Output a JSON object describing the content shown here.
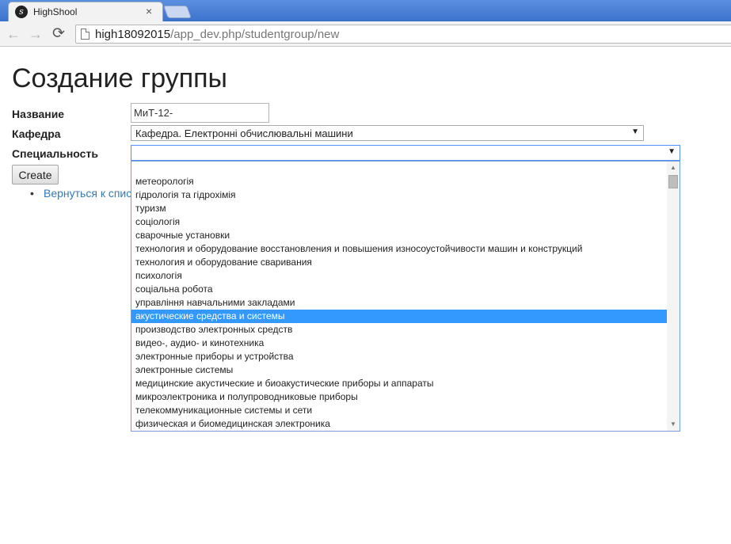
{
  "browser": {
    "tab_title": "HighShool",
    "tab_close": "×",
    "url_host": "high18092015",
    "url_path": "/app_dev.php/studentgroup/new",
    "back_glyph": "←",
    "forward_glyph": "→",
    "reload_glyph": "⟳",
    "favicon_letter": "s"
  },
  "page": {
    "title": "Создание группы",
    "labels": {
      "name": "Название",
      "department": "Кафедра",
      "specialty": "Специальность"
    },
    "name_value": "МиТ-12-",
    "department_value": "Кафедра. Електронні обчислювальні машини",
    "specialty_value": "",
    "select_arrow": "▼",
    "create_button": "Create",
    "back_link": "Вернуться к списку",
    "bullet": "•"
  },
  "dropdown": {
    "options": [
      "",
      "метеорологія",
      "гідрологія та гідрохімія",
      "туризм",
      "соціологія",
      "сварочные установки",
      "технология и оборудование восстановления и повышения износоустойчивости машин и конструкций",
      "технология и оборудование сваривания",
      "психологія",
      "соціальна робота",
      "управління навчальними закладами",
      "акустические средства и системы",
      "производство электронных средств",
      "видео-, аудио- и кинотехника",
      "электронные приборы и устройства",
      "электронные системы",
      "медицинские акустические и биоакустические приборы и аппараты",
      "микроэлектроника и полупроводниковые приборы",
      "телекоммуникационные системы и сети",
      "физическая и биомедицинская электроника"
    ],
    "highlighted_index": 11,
    "scroll_up": "▲",
    "scroll_down": "▼"
  },
  "colors": {
    "titlebar": "#4a7fd3",
    "highlight": "#3399ff",
    "link": "#337ab7"
  }
}
